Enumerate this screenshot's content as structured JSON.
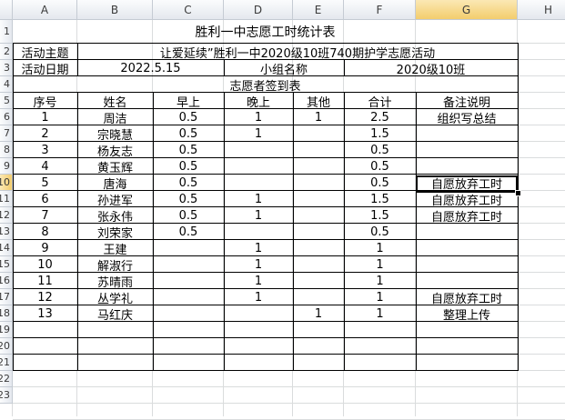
{
  "columns": [
    "A",
    "B",
    "C",
    "D",
    "E",
    "F",
    "G",
    "H"
  ],
  "row_numbers": [
    "1",
    "2",
    "3",
    "4",
    "5",
    "6",
    "7",
    "8",
    "9",
    "10",
    "11",
    "12",
    "13",
    "14",
    "15",
    "16",
    "17",
    "18",
    "19",
    "20",
    "21",
    "22",
    "23"
  ],
  "active": {
    "column": "G",
    "row": "10"
  },
  "title": "胜利一中志愿工时统计表",
  "theme_label": "活动主题",
  "theme_value": "让爱延续”胜利一中2020级10班740期护学志愿活动",
  "date_label": "活动日期",
  "date_value": "2022.5.15",
  "group_label": "小组名称",
  "group_value": "2020级10班",
  "signin_title": "志愿者签到表",
  "headers": [
    "序号",
    "姓名",
    "早上",
    "晚上",
    "其他",
    "合计",
    "备注说明"
  ],
  "rows": [
    [
      "1",
      "周洁",
      "0.5",
      "1",
      "1",
      "2.5",
      "组织写总结"
    ],
    [
      "2",
      "宗晓慧",
      "0.5",
      "1",
      "",
      "1.5",
      ""
    ],
    [
      "3",
      "杨友志",
      "0.5",
      "",
      "",
      "0.5",
      ""
    ],
    [
      "4",
      "黄玉辉",
      "0.5",
      "",
      "",
      "0.5",
      ""
    ],
    [
      "5",
      "唐海",
      "0.5",
      "",
      "",
      "0.5",
      "自愿放弃工时"
    ],
    [
      "6",
      "孙进军",
      "0.5",
      "1",
      "",
      "1.5",
      "自愿放弃工时"
    ],
    [
      "7",
      "张永伟",
      "0.5",
      "1",
      "",
      "1.5",
      "自愿放弃工时"
    ],
    [
      "8",
      "刘荣家",
      "0.5",
      "",
      "",
      "0.5",
      ""
    ],
    [
      "9",
      "王建",
      "",
      "1",
      "",
      "1",
      ""
    ],
    [
      "10",
      "解淑行",
      "",
      "1",
      "",
      "1",
      ""
    ],
    [
      "11",
      "苏晴雨",
      "",
      "1",
      "",
      "1",
      ""
    ],
    [
      "12",
      "丛学礼",
      "",
      "1",
      "",
      "1",
      "自愿放弃工时"
    ],
    [
      "13",
      "马红庆",
      "",
      "",
      "1",
      "1",
      "整理上传"
    ]
  ]
}
